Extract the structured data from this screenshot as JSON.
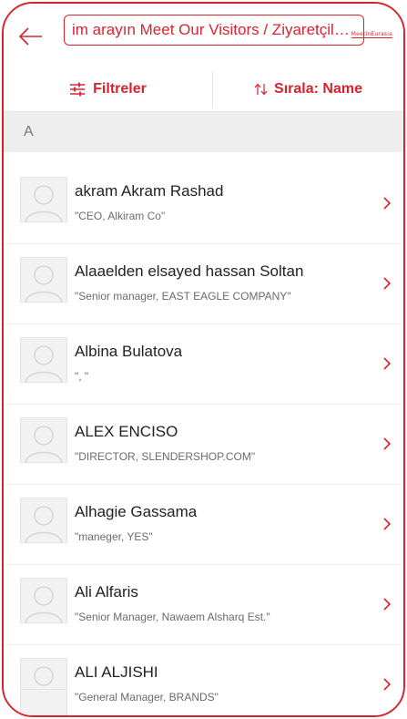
{
  "colors": {
    "accent": "#d8232f",
    "section_bg": "#eeeeef",
    "text_primary": "#222222",
    "text_secondary": "#6b6b6b"
  },
  "header": {
    "back_icon": "arrow-left-icon",
    "search_value": "im arayın Meet Our Visitors / Ziyaretçileri...",
    "logo_text": "MeetinEurasia"
  },
  "toolbar": {
    "filter_icon": "sliders-icon",
    "filter_label": "Filtreler",
    "sort_icon": "sort-arrows-icon",
    "sort_label": "Sırala: Name"
  },
  "section": {
    "letter": "A"
  },
  "rows": [
    {
      "name": "akram Akram Rashad",
      "subtitle": "\"CEO, Alkiram Co\""
    },
    {
      "name": "Alaaelden elsayed hassan Soltan",
      "subtitle": "\"Senior manager, EAST EAGLE COMPANY\""
    },
    {
      "name": "Albina Bulatova",
      "subtitle": "\", \""
    },
    {
      "name": "ALEX ENCISO",
      "subtitle": "\"DIRECTOR, SLENDERSHOP.COM\""
    },
    {
      "name": "Alhagie Gassama",
      "subtitle": "\"maneger, YES\""
    },
    {
      "name": "Ali Alfaris",
      "subtitle": "\"Senior Manager, Nawaem Alsharq Est.\""
    },
    {
      "name": "ALI ALJISHI",
      "subtitle": "\"General Manager, BRANDS\""
    }
  ]
}
